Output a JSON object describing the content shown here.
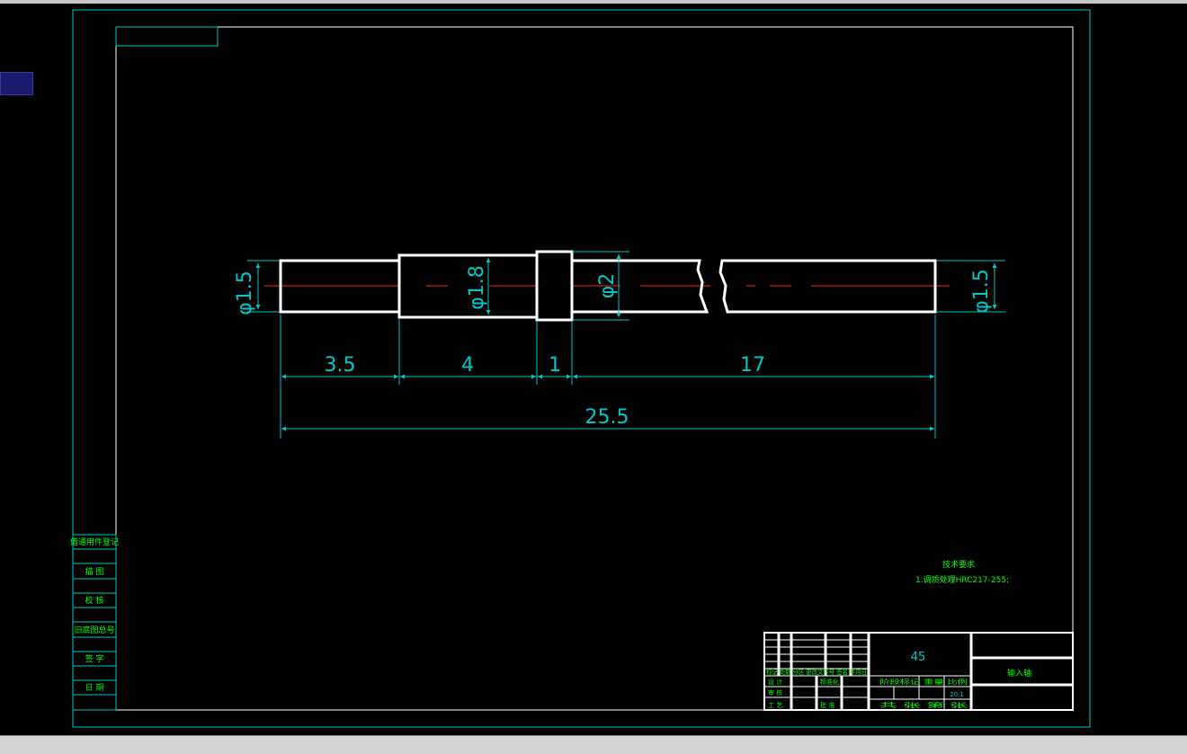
{
  "colors": {
    "background": "#000000",
    "frame": "#00c8c8",
    "part_outline": "#ffffff",
    "centerline": "#ff2020",
    "dimension": "#00c8c8",
    "annotation": "#00ff00"
  },
  "dimensions": {
    "dia_left": "φ1.5",
    "dia_mid": "φ1.8",
    "dia_collar": "φ2",
    "dia_right": "φ1.5",
    "len_1": "3.5",
    "len_2": "4",
    "len_3": "1",
    "len_4": "17",
    "len_total": "25.5"
  },
  "side_column": {
    "items": [
      "借通用件登记",
      "描 图",
      "校 核",
      "旧底图总号",
      "签 字",
      "日 期"
    ]
  },
  "technical_requirements": {
    "title": "技术要求",
    "line1": "1.调质处理HRC217-255;"
  },
  "title_block": {
    "material": "45",
    "part_name": "输入轴",
    "scale": "20:1",
    "label_stage_weight_scale": "阶段标记 重量 比例",
    "label_design": "设 计",
    "label_review": "审 核",
    "label_process": "工 艺",
    "label_standardize": "标准化",
    "label_approve": "批 准",
    "label_sheet": "共 张 第 张",
    "label_revision": "标记 处数 分区 更改文件号 签名 年月日"
  }
}
